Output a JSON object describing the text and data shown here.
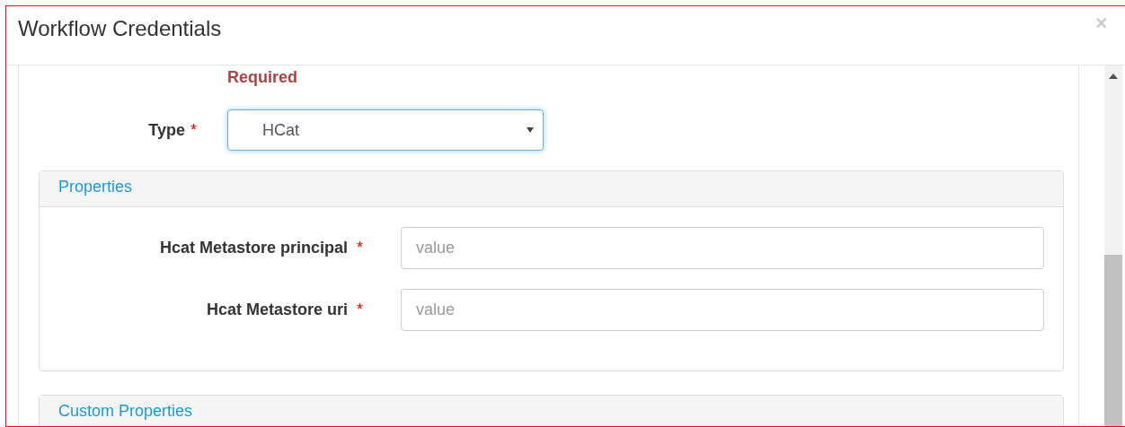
{
  "window": {
    "title": "Workflow Credentials",
    "close": "×"
  },
  "type_field": {
    "error": "Required",
    "label": "Type",
    "required_mark": "*",
    "value": "HCat",
    "focused": true
  },
  "panels": [
    {
      "title": "Properties",
      "fields": [
        {
          "label": "Hcat Metastore principal",
          "required_mark": "*",
          "placeholder": "value"
        },
        {
          "label": "Hcat Metastore uri",
          "required_mark": "*",
          "placeholder": "value"
        }
      ]
    },
    {
      "title": "Custom Properties"
    }
  ]
}
